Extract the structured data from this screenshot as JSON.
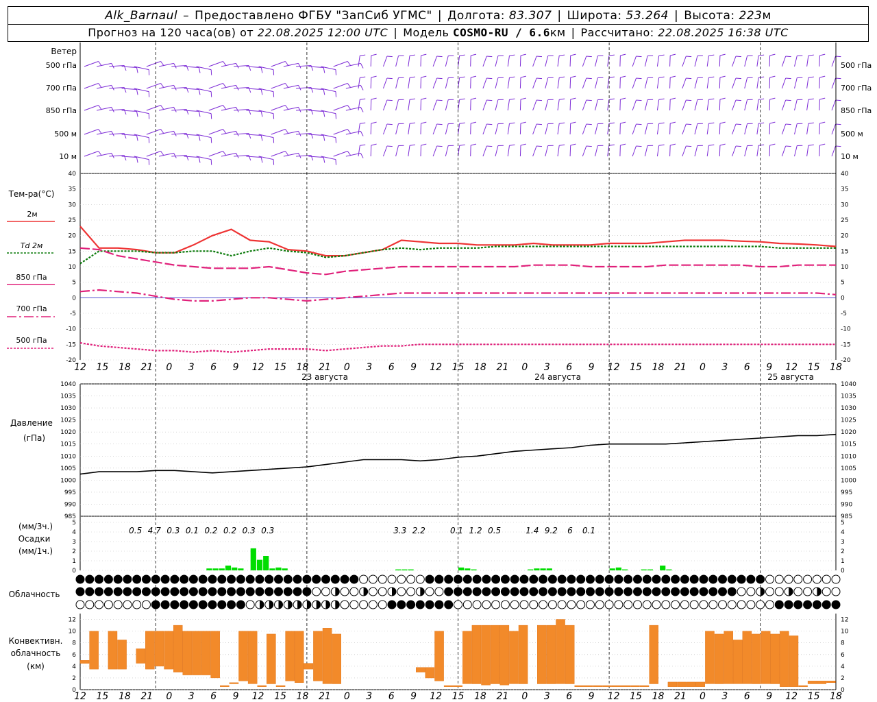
{
  "header": {
    "station": "Alk_Barnaul",
    "dash": "–",
    "provider": "Предоставлено ФГБУ \"ЗапСиб УГМС\"",
    "lon_label": "Долгота:",
    "lon": "83.307",
    "lat_label": "Широта:",
    "lat": "53.264",
    "alt_label": "Высота:",
    "alt": "223",
    "alt_unit": "м",
    "forecast_label": "Прогноз на 120 часа(ов) от",
    "forecast_start": "22.08.2025 12:00 UTC",
    "model_label": "Модель",
    "model": "COSMO-RU / 6.6",
    "model_unit": "км",
    "calc_label": "Рассчитано:",
    "calc_time": "22.08.2025 16:38 UTC"
  },
  "wind": {
    "title": "Ветер",
    "levels": [
      "500 гПа",
      "700 гПа",
      "850 гПа",
      "500 м",
      "10  м"
    ]
  },
  "temp_legend": {
    "title": "Тем-ра(°С)",
    "items": [
      {
        "label": "2м",
        "color": "#ee3333",
        "style": "solid"
      },
      {
        "label": "Td  2м",
        "color": "#0a7a0a",
        "style": "dotted"
      },
      {
        "label": "850 гПа",
        "color": "#e0207a",
        "style": "dashed"
      },
      {
        "label": "700 гПа",
        "color": "#e0207a",
        "style": "dashdot"
      },
      {
        "label": "500 гПа",
        "color": "#e0207a",
        "style": "dotted"
      }
    ]
  },
  "time_axis": {
    "ticks": [
      "12",
      "15",
      "18",
      "21",
      "0",
      "3",
      "6",
      "9",
      "12",
      "15",
      "18",
      "21",
      "0",
      "3",
      "6",
      "9",
      "12",
      "15",
      "18",
      "21",
      "0",
      "3",
      "6",
      "9",
      "12",
      "15",
      "18",
      "21",
      "0",
      "3",
      "6",
      "9",
      "12",
      "15",
      "18"
    ],
    "dates": [
      "23 августа",
      "24 августа",
      "25 августа"
    ]
  },
  "pressure_label": [
    "Давление",
    "(гПа)"
  ],
  "precip_label": [
    "(мм/3ч.)",
    "Осадки",
    "(мм/1ч.)"
  ],
  "cloud_label": "Облачность",
  "conv_label": [
    "Конвективн.",
    "облачность",
    "(км)"
  ],
  "chart_data": [
    {
      "type": "line",
      "name": "temperature",
      "x_hours": [
        0,
        3,
        6,
        9,
        12,
        15,
        18,
        21,
        24,
        27,
        30,
        33,
        36,
        39,
        42,
        45,
        48,
        51,
        54,
        57,
        60,
        63,
        66,
        69,
        72,
        75,
        78,
        81,
        84,
        87,
        90,
        93,
        96,
        99,
        102,
        105,
        108,
        111,
        114,
        117,
        120
      ],
      "ylim": [
        -20,
        40
      ],
      "yticks": [
        -20,
        -15,
        -10,
        -5,
        0,
        5,
        10,
        15,
        20,
        25,
        30,
        35,
        40
      ],
      "series": [
        {
          "name": "2м",
          "values": [
            23,
            16,
            16,
            15.5,
            14.5,
            14.5,
            17,
            20,
            22,
            18.5,
            18,
            15.5,
            15,
            13.5,
            13.5,
            14.5,
            15.5,
            18.5,
            18,
            17.5,
            17.5,
            17,
            17,
            17,
            17.5,
            17,
            17,
            17,
            17.5,
            17.5,
            17.5,
            18,
            18.5,
            18.5,
            18.5,
            18.2,
            18,
            17.5,
            17.3,
            17,
            16.5
          ]
        },
        {
          "name": "Td 2м",
          "values": [
            11,
            15,
            15,
            15,
            14.5,
            14.5,
            15,
            15,
            13.5,
            15,
            16,
            15,
            14.5,
            13,
            13.5,
            14.5,
            15.5,
            16,
            15.5,
            16,
            16,
            16,
            16.5,
            16.5,
            16.5,
            16.5,
            16.5,
            16.5,
            16.5,
            16.5,
            16.5,
            16.5,
            16.5,
            16.5,
            16.5,
            16.5,
            16.5,
            16,
            16,
            16,
            16
          ]
        },
        {
          "name": "850 гПа",
          "values": [
            16,
            15.5,
            13.5,
            12.5,
            11.5,
            10.5,
            10,
            9.5,
            9.5,
            9.5,
            10,
            9,
            8,
            7.5,
            8.5,
            9,
            9.5,
            10,
            10,
            10,
            10,
            10,
            10,
            10,
            10.5,
            10.5,
            10.5,
            10,
            10,
            10,
            10,
            10.5,
            10.5,
            10.5,
            10.5,
            10.5,
            10,
            10,
            10.5,
            10.5,
            10.5
          ]
        },
        {
          "name": "700 гПа",
          "values": [
            2,
            2.5,
            2,
            1.5,
            0.5,
            -0.5,
            -1,
            -1,
            -0.5,
            0,
            0,
            -0.5,
            -1,
            -0.5,
            0,
            0.5,
            1,
            1.5,
            1.5,
            1.5,
            1.5,
            1.5,
            1.5,
            1.5,
            1.5,
            1.5,
            1.5,
            1.5,
            1.5,
            1.5,
            1.5,
            1.5,
            1.5,
            1.5,
            1.5,
            1.5,
            1.5,
            1.5,
            1.5,
            1.5,
            1
          ]
        },
        {
          "name": "500 гПа",
          "values": [
            -14.5,
            -15.5,
            -16,
            -16.5,
            -17,
            -17,
            -17.5,
            -17,
            -17.5,
            -17,
            -16.5,
            -16.5,
            -16.5,
            -17,
            -16.5,
            -16,
            -15.5,
            -15.5,
            -15,
            -15,
            -15,
            -15,
            -15,
            -15,
            -15,
            -15,
            -15,
            -15,
            -15,
            -15,
            -15,
            -15,
            -15,
            -15,
            -15,
            -15,
            -15,
            -15,
            -15,
            -15,
            -15
          ]
        }
      ]
    },
    {
      "type": "line",
      "name": "pressure",
      "x_hours": [
        0,
        3,
        6,
        9,
        12,
        15,
        18,
        21,
        24,
        27,
        30,
        33,
        36,
        39,
        42,
        45,
        48,
        51,
        54,
        57,
        60,
        63,
        66,
        69,
        72,
        75,
        78,
        81,
        84,
        87,
        90,
        93,
        96,
        99,
        102,
        105,
        108,
        111,
        114,
        117,
        120
      ],
      "ylim": [
        985,
        1040
      ],
      "yticks": [
        985,
        990,
        995,
        1000,
        1005,
        1010,
        1015,
        1020,
        1025,
        1030,
        1035,
        1040
      ],
      "values": [
        1002.5,
        1003.5,
        1003.5,
        1003.5,
        1004,
        1004,
        1003.5,
        1003,
        1003.5,
        1004,
        1004.5,
        1005,
        1005.5,
        1006.5,
        1007.5,
        1008.5,
        1008.5,
        1008.5,
        1008,
        1008.5,
        1009.5,
        1010,
        1011,
        1012,
        1012.5,
        1013,
        1013.5,
        1014.5,
        1015,
        1015,
        1015,
        1015,
        1015.5,
        1016,
        1016.5,
        1017,
        1017.5,
        1018,
        1018.5,
        1018.5,
        1019
      ]
    },
    {
      "type": "bar",
      "name": "precipitation",
      "ylim": [
        0,
        5
      ],
      "yticks": [
        0,
        1,
        2,
        3,
        4,
        5
      ],
      "hourly": [
        0,
        0,
        0,
        0,
        0,
        0,
        0,
        0,
        0,
        0,
        0,
        0,
        0,
        0,
        0,
        0,
        0,
        0,
        0,
        0,
        0.2,
        0.2,
        0.2,
        0.5,
        0.3,
        0.2,
        0,
        2.3,
        1.1,
        1.5,
        0.2,
        0.3,
        0.2,
        0,
        0,
        0,
        0,
        0,
        0,
        0,
        0,
        0,
        0,
        0,
        0,
        0,
        0,
        0,
        0,
        0,
        0.1,
        0.1,
        0.1,
        0,
        0,
        0,
        0,
        0,
        0,
        0,
        0.3,
        0.2,
        0.1,
        0,
        0,
        0,
        0,
        0,
        0,
        0,
        0,
        0.1,
        0.2,
        0.2,
        0.2,
        0,
        0,
        0,
        0,
        0,
        0,
        0,
        0,
        0,
        0.2,
        0.3,
        0.1,
        0,
        0,
        0.1,
        0.1,
        0,
        0.5,
        0.1,
        0,
        0,
        0,
        0,
        0,
        0,
        0,
        0,
        0,
        0,
        0,
        0,
        0,
        0,
        0,
        0,
        0,
        0,
        0,
        0,
        0,
        0,
        0,
        0,
        0,
        0,
        0,
        0,
        0,
        0,
        0,
        0,
        0,
        0,
        0,
        0,
        0,
        0,
        0,
        0,
        0,
        0,
        0,
        0,
        0,
        0,
        0,
        0,
        0,
        0,
        0,
        0,
        0,
        0,
        0,
        0,
        0,
        0,
        0,
        0,
        0,
        0,
        0,
        0,
        0,
        0,
        0
      ],
      "three_hour_labels": [
        {
          "hour": 9,
          "value": "0.5"
        },
        {
          "hour": 12,
          "value": "4.7"
        },
        {
          "hour": 15,
          "value": "0.3"
        },
        {
          "hour": 18,
          "value": "0.1"
        },
        {
          "hour": 21,
          "value": "0.2"
        },
        {
          "hour": 24,
          "value": "0.2"
        },
        {
          "hour": 27,
          "value": "0.3"
        },
        {
          "hour": 30,
          "value": "0.3"
        },
        {
          "hour": 51,
          "value": "3.3"
        },
        {
          "hour": 54,
          "value": "2.2"
        },
        {
          "hour": 60,
          "value": "0.1"
        },
        {
          "hour": 63,
          "value": "1.2"
        },
        {
          "hour": 66,
          "value": "0.5"
        },
        {
          "hour": 72,
          "value": "1.4"
        },
        {
          "hour": 75,
          "value": "9.2"
        },
        {
          "hour": 78,
          "value": "6"
        },
        {
          "hour": 81,
          "value": "0.1"
        }
      ]
    },
    {
      "type": "bar",
      "name": "convective_cloud",
      "ylim": [
        0,
        13
      ],
      "yticks": [
        0,
        2,
        4,
        6,
        8,
        10,
        12
      ],
      "segments_km": [
        [
          0,
          4.5,
          5
        ],
        [
          1,
          3.5,
          10
        ],
        [
          3,
          3.5,
          10
        ],
        [
          4,
          3.5,
          8.5
        ],
        [
          6,
          4.5,
          7
        ],
        [
          7,
          3.5,
          10
        ],
        [
          8,
          4,
          10
        ],
        [
          9,
          3.5,
          10
        ],
        [
          10,
          3,
          11
        ],
        [
          11,
          2.5,
          10
        ],
        [
          12,
          2.5,
          10
        ],
        [
          13,
          2.5,
          10
        ],
        [
          14,
          2,
          10
        ],
        [
          15,
          0.5,
          0.7
        ],
        [
          16,
          1,
          1.2
        ],
        [
          17,
          1.5,
          10
        ],
        [
          18,
          1,
          10
        ],
        [
          19,
          0.5,
          0.7
        ],
        [
          20,
          1,
          9.5
        ],
        [
          21,
          0.5,
          0.7
        ],
        [
          22,
          1.5,
          10
        ],
        [
          23,
          1.2,
          10
        ],
        [
          24,
          3.5,
          4.5
        ],
        [
          25,
          1.5,
          10
        ],
        [
          26,
          1,
          10.5
        ],
        [
          27,
          1,
          9.5
        ],
        [
          36,
          3,
          3.8
        ],
        [
          37,
          2,
          3.8
        ],
        [
          38,
          1.5,
          10
        ],
        [
          39,
          0.5,
          0.7
        ],
        [
          40,
          0.5,
          0.7
        ],
        [
          41,
          1,
          10
        ],
        [
          42,
          1,
          11
        ],
        [
          43,
          0.8,
          11
        ],
        [
          44,
          1,
          11
        ],
        [
          45,
          0.8,
          11
        ],
        [
          46,
          1,
          10
        ],
        [
          47,
          1,
          11
        ],
        [
          49,
          1,
          11
        ],
        [
          50,
          1,
          11
        ],
        [
          51,
          1,
          12
        ],
        [
          52,
          1,
          11
        ],
        [
          53,
          0.5,
          0.7
        ],
        [
          54,
          0.5,
          0.7
        ],
        [
          55,
          0.5,
          0.7
        ],
        [
          56,
          0.5,
          0.7
        ],
        [
          57,
          0.5,
          0.7
        ],
        [
          58,
          0.5,
          0.7
        ],
        [
          59,
          0.5,
          0.7
        ],
        [
          60,
          0.5,
          0.7
        ],
        [
          61,
          1,
          11
        ],
        [
          63,
          0.5,
          1.3
        ],
        [
          64,
          0.5,
          1.3
        ],
        [
          65,
          0.5,
          1.3
        ],
        [
          66,
          0.5,
          1.3
        ],
        [
          67,
          1,
          10
        ],
        [
          68,
          1,
          9.5
        ],
        [
          69,
          1,
          10
        ],
        [
          70,
          1,
          8.5
        ],
        [
          71,
          1,
          10
        ],
        [
          72,
          1,
          9.5
        ],
        [
          73,
          1,
          10
        ],
        [
          74,
          1,
          9.5
        ],
        [
          75,
          0.5,
          10
        ],
        [
          76,
          0.5,
          9.2
        ],
        [
          77,
          0.5,
          0.7
        ],
        [
          78,
          1,
          1.5
        ],
        [
          79,
          1,
          1.5
        ],
        [
          80,
          1.2,
          1.5
        ]
      ]
    }
  ],
  "colors": {
    "temp2m": "#ee3333",
    "dew": "#0a7a0a",
    "upper": "#e0207a",
    "precip": "#00dd00",
    "conv": "#f28a2a",
    "wind": "#7c2ad6",
    "pressure": "#000000",
    "zero_line": "#3333cc"
  }
}
